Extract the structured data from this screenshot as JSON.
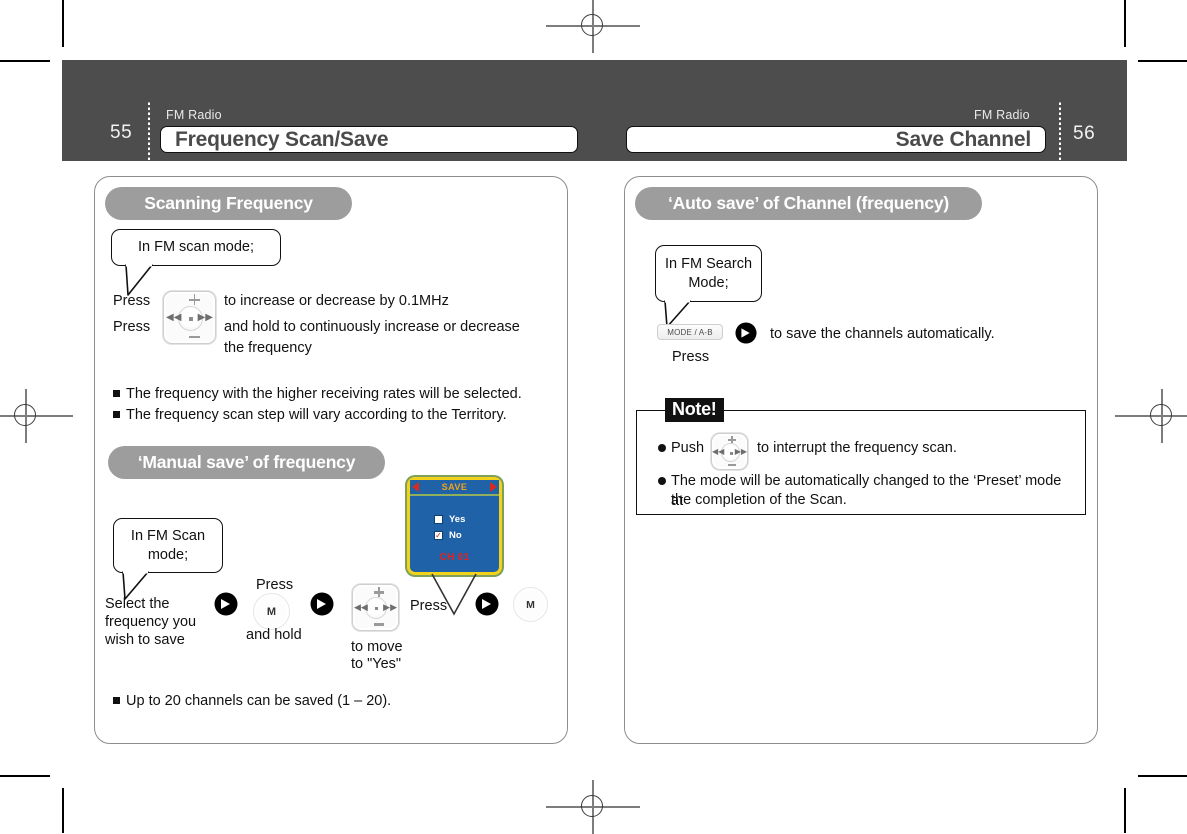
{
  "header": {
    "left": {
      "page_number": "55",
      "kicker": "FM Radio",
      "title": "Frequency Scan/Save"
    },
    "right": {
      "page_number": "56",
      "kicker": "FM Radio",
      "title": "Save Channel"
    }
  },
  "left_panel": {
    "section1": {
      "heading": "Scanning Frequency",
      "callout": "In FM scan mode;",
      "line1_pre": "Press",
      "line1_post": "to increase or decrease by 0.1MHz",
      "line2_pre": "Press",
      "line2_post": "and hold to continuously increase or decrease",
      "line2_post2": "the frequency",
      "bullets": [
        "The frequency with the higher receiving rates will be selected.",
        "The frequency scan step will vary according to the Territory."
      ]
    },
    "section2": {
      "heading": "‘Manual save’ of frequency",
      "callout_line1": "In FM Scan",
      "callout_line2": "mode;",
      "step1_line1": "Select the",
      "step1_line2": "frequency you",
      "step1_line3": "wish to save",
      "step2_above": "Press",
      "step2_below": "and hold",
      "step2_key": "M",
      "step3_below1": "to move",
      "step3_below2": "to \"Yes\"",
      "step4_label": "Press",
      "step5_key": "M",
      "bullet": "Up to 20 channels can be saved (1 – 20)."
    },
    "lcd": {
      "title": "SAVE",
      "option_yes": "Yes",
      "option_no": "No",
      "yes_checked": "",
      "no_checked": "✓",
      "channel": "CH 01"
    }
  },
  "right_panel": {
    "section1": {
      "heading": "‘Auto save’ of Channel (frequency)",
      "callout_line1": "In FM Search",
      "callout_line2": "Mode;",
      "mode_button": "MODE / A-B",
      "press_label": "Press",
      "description": "to save the channels automatically."
    },
    "note": {
      "tag": "Note!",
      "item1_pre": "Push",
      "item1_post": "to interrupt the frequency scan.",
      "item2_line1": "The mode will be automatically changed to the ‘Preset’ mode at",
      "item2_line2": "the completion of the Scan."
    }
  },
  "dpad": {
    "plus": "+",
    "minus": "–",
    "prev": "◀◀",
    "next": "▶▶",
    "center": "■"
  },
  "colors": {
    "header_band": "#4d4d4d",
    "pill": "#9d9d9d",
    "lcd_screen": "#1f62a8",
    "lcd_border": "#f2d21a",
    "lcd_title_text": "#f3a21a",
    "lcd_channel": "#e8201a",
    "arrow": "#000000"
  }
}
